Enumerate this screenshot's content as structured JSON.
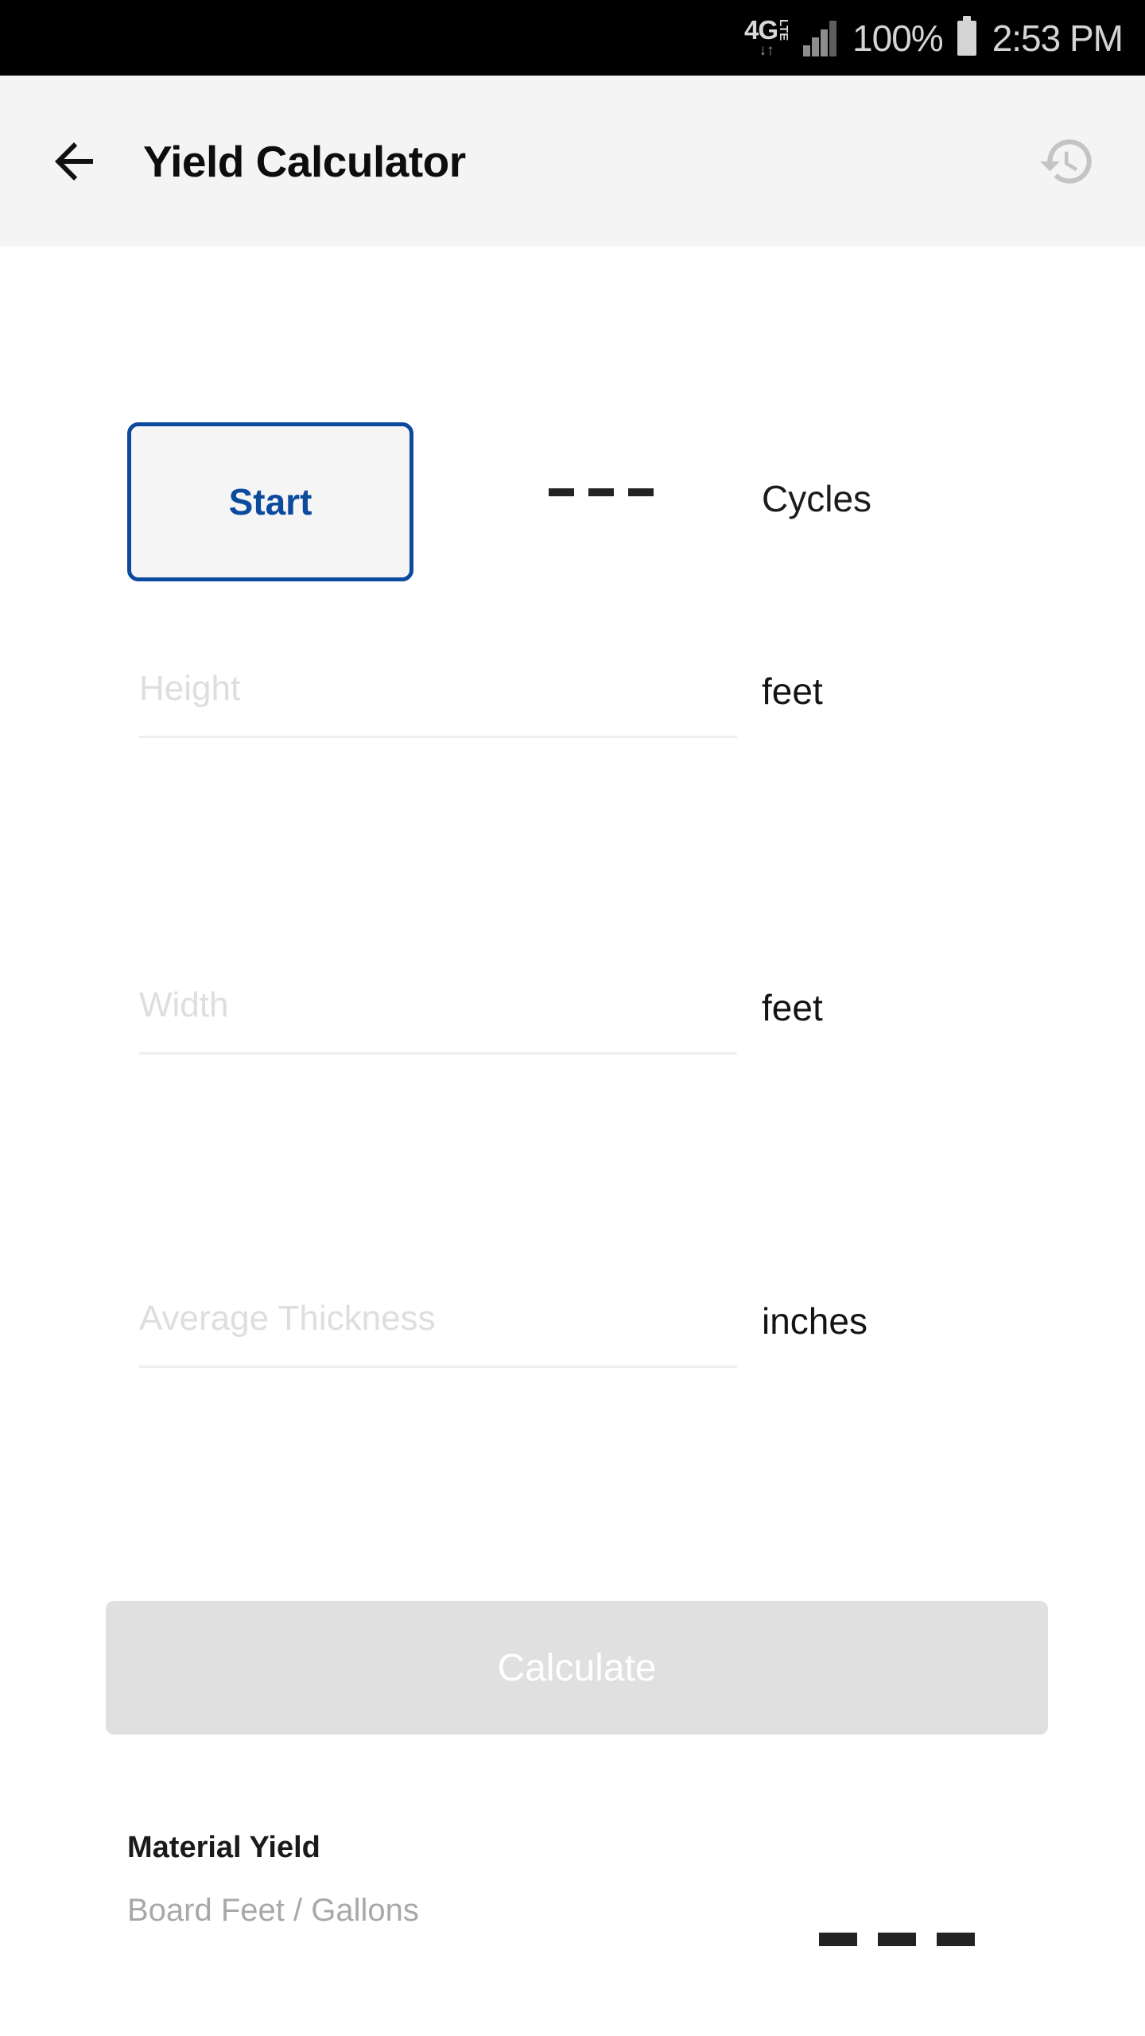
{
  "status_bar": {
    "network_type": "4G",
    "network_suffix": "LTE",
    "data_arrows": "↓↑",
    "signal_icon": "signal-bars-icon",
    "battery_percent": "100%",
    "battery_icon": "battery-full-icon",
    "time": "2:53 PM"
  },
  "app_bar": {
    "back_icon": "arrow-left-icon",
    "title": "Yield Calculator",
    "history_icon": "history-icon",
    "background_color": "#f4f4f4"
  },
  "main": {
    "start": {
      "button_label": "Start",
      "button_border_color": "#0c4a9e",
      "button_text_color": "#0c4a9e",
      "cycles_value": "_ _ _",
      "cycles_label": "Cycles"
    },
    "fields": [
      {
        "name": "height",
        "placeholder": "Height",
        "value": "",
        "unit": "feet"
      },
      {
        "name": "width",
        "placeholder": "Width",
        "value": "",
        "unit": "feet"
      },
      {
        "name": "average-thickness",
        "placeholder": "Average Thickness",
        "value": "",
        "unit": "inches"
      }
    ],
    "calculate": {
      "label": "Calculate",
      "disabled_background": "#e0e0e0",
      "text_color": "#ffffff"
    },
    "result": {
      "title": "Material Yield",
      "subtitle": "Board Feet / Gallons",
      "value": "— — —"
    }
  }
}
